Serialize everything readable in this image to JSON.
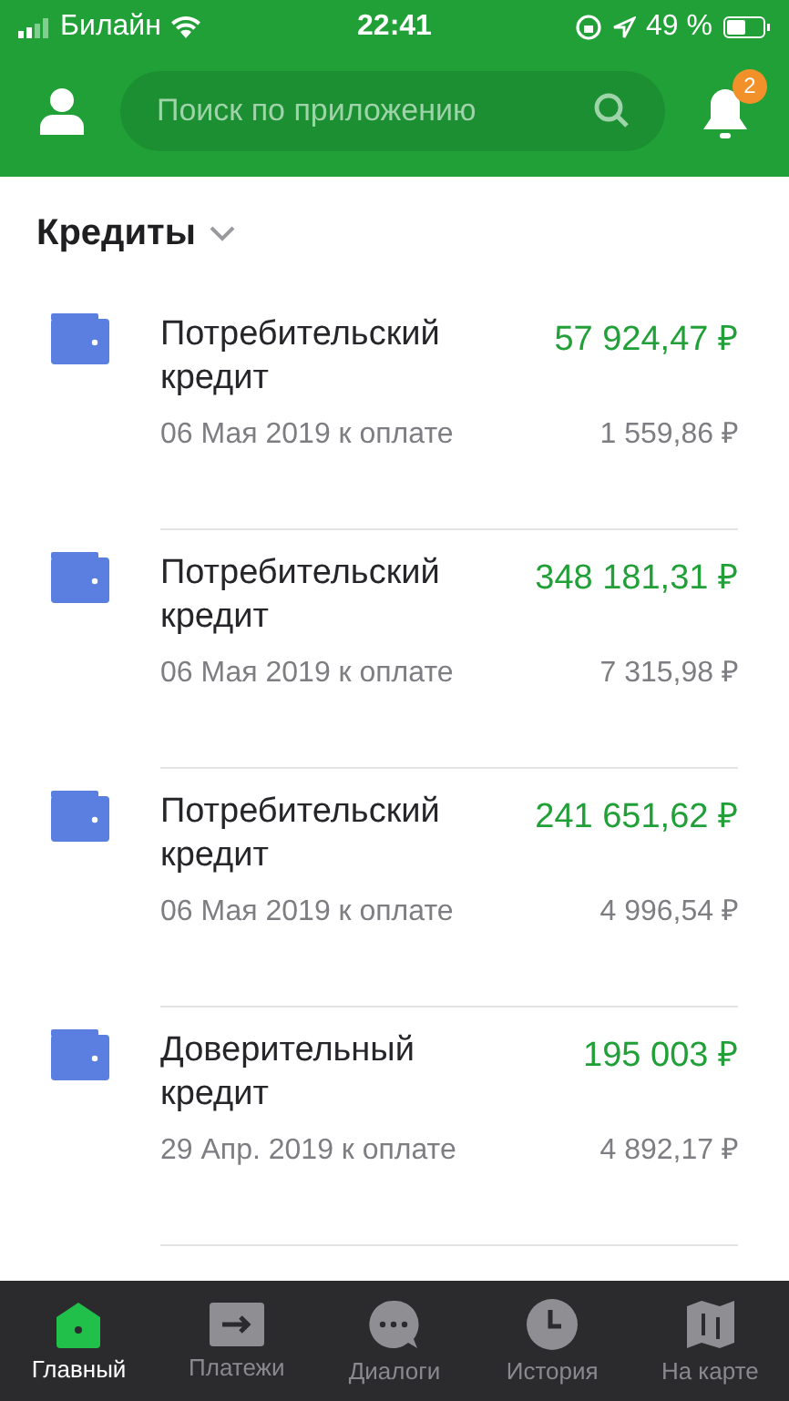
{
  "status_bar": {
    "carrier": "Билайн",
    "time": "22:41",
    "battery": "49 %"
  },
  "header": {
    "search": {
      "placeholder": "Поиск по приложению"
    },
    "notifications_badge": "2"
  },
  "section": {
    "title": "Кредиты"
  },
  "loans": [
    {
      "name": "Потребительский кредит",
      "amount": "57 924,47 ₽",
      "due": "06 Мая 2019 к оплате",
      "payment": "1 559,86 ₽"
    },
    {
      "name": "Потребительский кредит",
      "amount": "348 181,31 ₽",
      "due": "06 Мая 2019 к оплате",
      "payment": "7 315,98 ₽"
    },
    {
      "name": "Потребительский кредит",
      "amount": "241 651,62 ₽",
      "due": "06 Мая 2019 к оплате",
      "payment": "4 996,54 ₽"
    },
    {
      "name": "Доверительный кредит",
      "amount": "195 003 ₽",
      "due": "29 Апр. 2019 к оплате",
      "payment": "4 892,17 ₽"
    }
  ],
  "tab_bar": [
    {
      "kind": "home",
      "label": "Главный",
      "selected": true
    },
    {
      "kind": "payments",
      "label": "Платежи",
      "selected": false
    },
    {
      "kind": "dialogs",
      "label": "Диалоги",
      "selected": false
    },
    {
      "kind": "history",
      "label": "История",
      "selected": false
    },
    {
      "kind": "map",
      "label": "На карте",
      "selected": false
    }
  ]
}
